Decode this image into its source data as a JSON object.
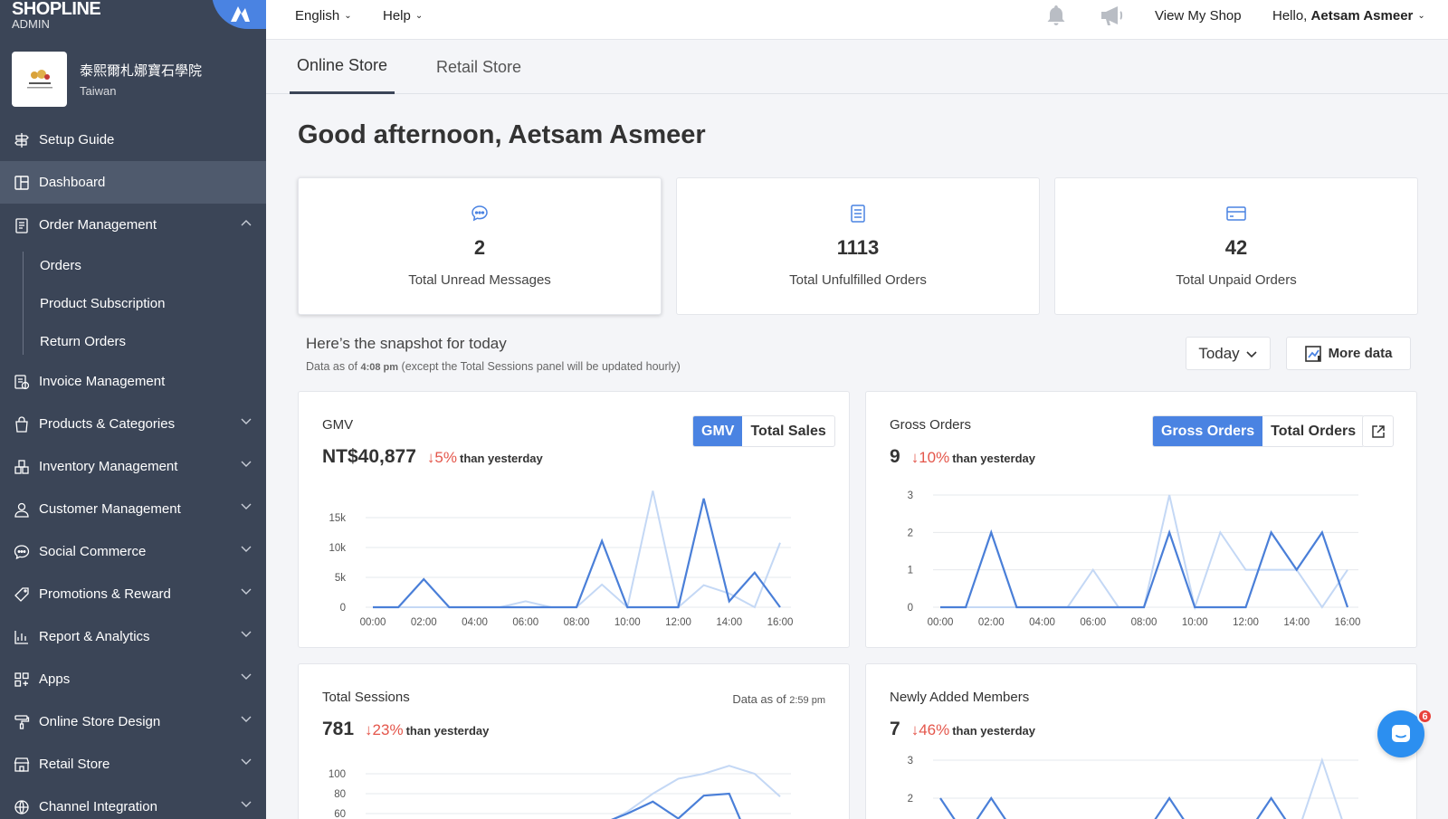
{
  "brand": {
    "name": "SHOPLINE",
    "sub": "ADMIN"
  },
  "shop": {
    "name": "泰熙爾札娜寶石學院",
    "region": "Taiwan"
  },
  "sidebar": {
    "items": [
      {
        "label": "Setup Guide",
        "icon": "signpost-icon"
      },
      {
        "label": "Dashboard",
        "icon": "dashboard-icon",
        "active": true
      },
      {
        "label": "Order Management",
        "icon": "clipboard-icon",
        "expanded": true,
        "children": [
          "Orders",
          "Product Subscription",
          "Return Orders"
        ]
      },
      {
        "label": "Invoice Management",
        "icon": "invoice-icon"
      },
      {
        "label": "Products & Categories",
        "icon": "bag-icon"
      },
      {
        "label": "Inventory Management",
        "icon": "inventory-icon"
      },
      {
        "label": "Customer Management",
        "icon": "person-icon"
      },
      {
        "label": "Social Commerce",
        "icon": "chat-bubble-icon"
      },
      {
        "label": "Promotions & Reward",
        "icon": "tag-icon"
      },
      {
        "label": "Report & Analytics",
        "icon": "chart-icon"
      },
      {
        "label": "Apps",
        "icon": "apps-icon"
      },
      {
        "label": "Online Store Design",
        "icon": "paint-roller-icon"
      },
      {
        "label": "Retail Store",
        "icon": "store-icon"
      },
      {
        "label": "Channel Integration",
        "icon": "globe-icon"
      }
    ]
  },
  "topbar": {
    "language": "English",
    "help": "Help",
    "view_shop": "View My Shop",
    "hello": "Hello,",
    "user": "Aetsam Asmeer"
  },
  "tabs": [
    "Online Store",
    "Retail Store"
  ],
  "greeting": "Good afternoon, Aetsam Asmeer",
  "stats": [
    {
      "value": "2",
      "label": "Total Unread Messages",
      "icon": "message-icon"
    },
    {
      "value": "1113",
      "label": "Total Unfulfilled Orders",
      "icon": "document-icon"
    },
    {
      "value": "42",
      "label": "Total Unpaid Orders",
      "icon": "credit-card-icon"
    }
  ],
  "snapshot": {
    "title": "Here’s the snapshot for today",
    "sub_prefix": "Data as of",
    "sub_time": "4:08 pm",
    "sub_suffix": "(except the Total Sessions panel will be updated hourly)",
    "range": "Today",
    "more": "More data"
  },
  "panels": {
    "gmv": {
      "title": "GMV",
      "value": "NT$40,877",
      "delta": "5%",
      "than": "than yesterday",
      "toggle": [
        "GMV",
        "Total Sales"
      ]
    },
    "orders": {
      "title": "Gross Orders",
      "value": "9",
      "delta": "10%",
      "than": "than yesterday",
      "toggle": [
        "Gross Orders",
        "Total Orders"
      ]
    },
    "sessions": {
      "title": "Total Sessions",
      "value": "781",
      "delta": "23%",
      "than": "than yesterday",
      "asof": "Data as of",
      "asof_time": "2:59 pm"
    },
    "members": {
      "title": "Newly Added Members",
      "value": "7",
      "delta": "46%",
      "than": "than yesterday"
    }
  },
  "notifications": {
    "chat_badge": "6"
  },
  "colors": {
    "sidebar": "#3b4557",
    "accent": "#4a83e2",
    "down": "#e4564b",
    "series_today": "#4a7fd8",
    "series_yesterday": "#c4d8f5"
  },
  "chart_data": [
    {
      "type": "line",
      "title": "GMV",
      "x": [
        "00:00",
        "01:00",
        "02:00",
        "03:00",
        "04:00",
        "05:00",
        "06:00",
        "07:00",
        "08:00",
        "09:00",
        "10:00",
        "11:00",
        "12:00",
        "13:00",
        "14:00",
        "15:00",
        "16:00"
      ],
      "xticks": [
        "00:00",
        "02:00",
        "04:00",
        "06:00",
        "08:00",
        "10:00",
        "12:00",
        "14:00",
        "16:00"
      ],
      "yticks": [
        "0",
        "5k",
        "10k",
        "15k"
      ],
      "ylim": [
        0,
        20000
      ],
      "series": [
        {
          "values": [
            0,
            0,
            4700,
            0,
            0,
            0,
            0,
            0,
            0,
            11100,
            0,
            0,
            0,
            18200,
            1000,
            5800,
            0
          ]
        },
        {
          "values": [
            0,
            0,
            0,
            0,
            0,
            0,
            1000,
            0,
            0,
            3800,
            0,
            19500,
            0,
            3700,
            2300,
            0,
            10800
          ]
        }
      ]
    },
    {
      "type": "line",
      "title": "Gross Orders",
      "x": [
        "00:00",
        "01:00",
        "02:00",
        "03:00",
        "04:00",
        "05:00",
        "06:00",
        "07:00",
        "08:00",
        "09:00",
        "10:00",
        "11:00",
        "12:00",
        "13:00",
        "14:00",
        "15:00",
        "16:00"
      ],
      "xticks": [
        "00:00",
        "02:00",
        "04:00",
        "06:00",
        "08:00",
        "10:00",
        "12:00",
        "14:00",
        "16:00"
      ],
      "yticks": [
        "0",
        "1",
        "2",
        "3"
      ],
      "ylim": [
        0,
        3
      ],
      "series": [
        {
          "values": [
            0,
            0,
            2,
            0,
            0,
            0,
            0,
            0,
            0,
            2,
            0,
            0,
            0,
            2,
            1,
            2,
            0
          ]
        },
        {
          "values": [
            0,
            0,
            0,
            0,
            0,
            0,
            1,
            0,
            0,
            3,
            0,
            2,
            1,
            1,
            1,
            0,
            1
          ]
        }
      ]
    },
    {
      "type": "line",
      "title": "Total Sessions",
      "x": [
        "00:00",
        "01:00",
        "02:00",
        "03:00",
        "04:00",
        "05:00",
        "06:00",
        "07:00",
        "08:00",
        "09:00",
        "10:00",
        "11:00",
        "12:00",
        "13:00",
        "14:00",
        "15:00",
        "16:00"
      ],
      "yticks": [
        "60",
        "80",
        "100"
      ],
      "ylim": [
        40,
        120
      ],
      "series": [
        {
          "values": [
            20,
            20,
            20,
            20,
            20,
            20,
            20,
            20,
            20,
            50,
            60,
            72,
            55,
            78,
            80,
            20,
            20
          ]
        },
        {
          "values": [
            20,
            20,
            20,
            20,
            20,
            20,
            20,
            20,
            20,
            48,
            62,
            80,
            95,
            100,
            108,
            100,
            77
          ]
        }
      ]
    },
    {
      "type": "line",
      "title": "Newly Added Members",
      "x": [
        "00:00",
        "01:00",
        "02:00",
        "03:00",
        "04:00",
        "05:00",
        "06:00",
        "07:00",
        "08:00",
        "09:00",
        "10:00",
        "11:00",
        "12:00",
        "13:00",
        "14:00",
        "15:00",
        "16:00"
      ],
      "yticks": [
        "2",
        "3"
      ],
      "ylim": [
        0,
        3
      ],
      "series": [
        {
          "values": [
            2,
            1,
            2,
            1,
            1,
            1,
            1,
            1,
            1,
            2,
            1,
            1,
            1,
            2,
            1,
            1,
            1
          ]
        },
        {
          "values": [
            1,
            1,
            1,
            1,
            1,
            1,
            1,
            1,
            1,
            1,
            1,
            1,
            1,
            1,
            1,
            3,
            1
          ]
        }
      ]
    }
  ]
}
